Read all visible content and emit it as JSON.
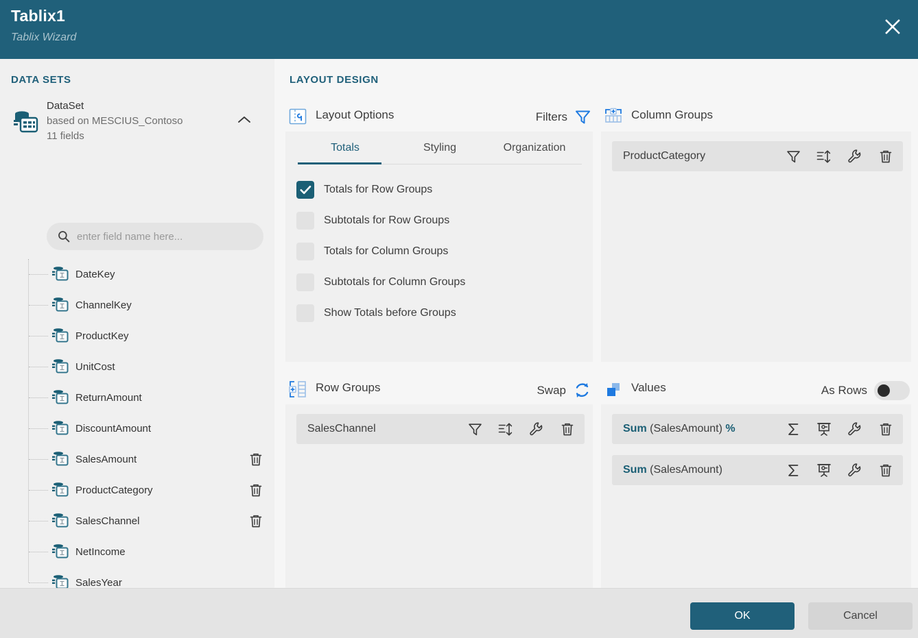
{
  "window": {
    "title": "Tablix1",
    "subtitle": "Tablix Wizard",
    "close_icon": "close-icon"
  },
  "sidebar": {
    "section_title": "DATA SETS",
    "dataset": {
      "name": "DataSet",
      "based_on": "based on MESCIUS_Contoso",
      "field_count": "11 fields",
      "collapse_icon": "chevron-up-icon",
      "icon": "database-table-icon"
    },
    "search": {
      "placeholder": "enter field name here...",
      "value": "",
      "icon": "search-icon"
    },
    "fields": [
      {
        "name": "DateKey",
        "deletable": false
      },
      {
        "name": "ChannelKey",
        "deletable": false
      },
      {
        "name": "ProductKey",
        "deletable": false
      },
      {
        "name": "UnitCost",
        "deletable": false
      },
      {
        "name": "ReturnAmount",
        "deletable": false
      },
      {
        "name": "DiscountAmount",
        "deletable": false
      },
      {
        "name": "SalesAmount",
        "deletable": true
      },
      {
        "name": "ProductCategory",
        "deletable": true
      },
      {
        "name": "SalesChannel",
        "deletable": true
      },
      {
        "name": "NetIncome",
        "deletable": false
      },
      {
        "name": "SalesYear",
        "deletable": false
      }
    ]
  },
  "main": {
    "section_title": "LAYOUT DESIGN",
    "layout_options": {
      "title": "Layout Options",
      "icon": "layout-options-icon",
      "filters_label": "Filters",
      "filters_icon": "filter-icon",
      "tabs": [
        {
          "label": "Totals",
          "active": true
        },
        {
          "label": "Styling",
          "active": false
        },
        {
          "label": "Organization",
          "active": false
        }
      ],
      "checkboxes": [
        {
          "label": "Totals for Row Groups",
          "checked": true
        },
        {
          "label": "Subtotals for Row Groups",
          "checked": false
        },
        {
          "label": "Totals for Column Groups",
          "checked": false
        },
        {
          "label": "Subtotals for Column Groups",
          "checked": false
        },
        {
          "label": "Show Totals before Groups",
          "checked": false
        }
      ]
    },
    "column_groups": {
      "title": "Column Groups",
      "icon": "column-groups-icon",
      "items": [
        {
          "label": "ProductCategory",
          "icons": [
            "filter-icon",
            "sort-icon",
            "wrench-icon",
            "trash-icon"
          ]
        }
      ]
    },
    "row_groups": {
      "title": "Row Groups",
      "icon": "row-groups-icon",
      "swap_label": "Swap",
      "swap_icon": "swap-refresh-icon",
      "items": [
        {
          "label": "SalesChannel",
          "icons": [
            "filter-icon",
            "sort-icon",
            "wrench-icon",
            "trash-icon"
          ]
        }
      ]
    },
    "values": {
      "title": "Values",
      "icon": "values-icon",
      "as_rows_label": "As Rows",
      "as_rows_on": false,
      "items": [
        {
          "aggregate": "Sum",
          "field": "(SalesAmount)",
          "suffix": "%",
          "icons": [
            "sigma-icon",
            "presentation-icon",
            "wrench-icon",
            "trash-icon"
          ]
        },
        {
          "aggregate": "Sum",
          "field": "(SalesAmount)",
          "suffix": "",
          "icons": [
            "sigma-icon",
            "presentation-icon",
            "wrench-icon",
            "trash-icon"
          ]
        }
      ]
    }
  },
  "footer": {
    "ok_label": "OK",
    "cancel_label": "Cancel"
  },
  "colors": {
    "header_bg": "#20607a",
    "accent": "#1b5f75",
    "panel_bg": "#f0f0f0",
    "chip_bg": "#e2e2e2",
    "footer_bg": "#e4e4e4",
    "icon_blue": "#1f7ae0"
  }
}
